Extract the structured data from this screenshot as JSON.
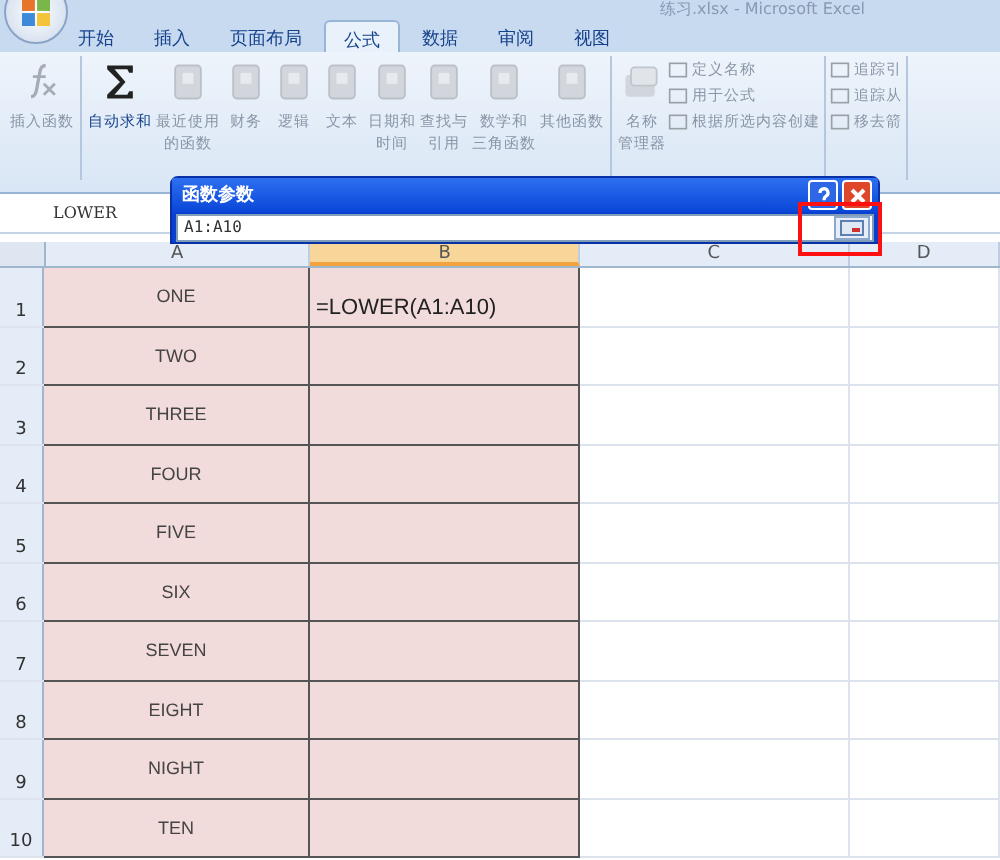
{
  "window": {
    "title": "练习.xlsx - Microsoft Excel"
  },
  "tabs": [
    {
      "label": "开始",
      "selected": false
    },
    {
      "label": "插入",
      "selected": false
    },
    {
      "label": "页面布局",
      "selected": false
    },
    {
      "label": "公式",
      "selected": true
    },
    {
      "label": "数据",
      "selected": false
    },
    {
      "label": "审阅",
      "selected": false
    },
    {
      "label": "视图",
      "selected": false
    }
  ],
  "ribbon": {
    "groups": [
      {
        "items": [
          {
            "kind": "big",
            "lines": [
              "插入函数"
            ],
            "enabled": false
          }
        ]
      },
      {
        "items": [
          {
            "kind": "big",
            "lines": [
              "自动求和"
            ],
            "enabled": true
          },
          {
            "kind": "big",
            "lines": [
              "最近使用",
              "的函数"
            ],
            "enabled": false
          },
          {
            "kind": "big",
            "lines": [
              "财务"
            ],
            "enabled": false
          },
          {
            "kind": "big",
            "lines": [
              "逻辑"
            ],
            "enabled": false
          },
          {
            "kind": "big",
            "lines": [
              "文本"
            ],
            "enabled": false
          },
          {
            "kind": "big",
            "lines": [
              "日期和",
              "时间"
            ],
            "enabled": false
          },
          {
            "kind": "big",
            "lines": [
              "查找与",
              "引用"
            ],
            "enabled": false
          },
          {
            "kind": "big",
            "lines": [
              "数学和",
              "三角函数"
            ],
            "enabled": false
          },
          {
            "kind": "big",
            "lines": [
              "其他函数"
            ],
            "enabled": false
          }
        ]
      },
      {
        "items": [
          {
            "kind": "big",
            "lines": [
              "名称",
              "管理器"
            ],
            "enabled": false
          },
          {
            "kind": "small",
            "lines": [
              "定义名称"
            ],
            "enabled": false
          },
          {
            "kind": "small",
            "lines": [
              "用于公式"
            ],
            "enabled": false
          },
          {
            "kind": "small",
            "lines": [
              "根据所选内容创建"
            ],
            "enabled": false
          }
        ]
      },
      {
        "items": [
          {
            "kind": "small",
            "lines": [
              "追踪引"
            ],
            "enabled": false
          },
          {
            "kind": "small",
            "lines": [
              "追踪从"
            ],
            "enabled": false
          },
          {
            "kind": "small",
            "lines": [
              "移去箭"
            ],
            "enabled": false
          }
        ]
      }
    ]
  },
  "name_box": "LOWER",
  "dialog": {
    "title": "函数参数",
    "value": "A1:A10"
  },
  "columns": [
    "A",
    "B",
    "C",
    "D"
  ],
  "rows": [
    {
      "number": "1",
      "a": "ONE",
      "b": "=LOWER(A1:A10)"
    },
    {
      "number": "2",
      "a": "TWO"
    },
    {
      "number": "3",
      "a": "THREE"
    },
    {
      "number": "4",
      "a": "FOUR"
    },
    {
      "number": "5",
      "a": "FIVE"
    },
    {
      "number": "6",
      "a": "SIX"
    },
    {
      "number": "7",
      "a": "SEVEN"
    },
    {
      "number": "8",
      "a": "EIGHT"
    },
    {
      "number": "9",
      "a": "NIGHT"
    },
    {
      "number": "10",
      "a": "TEN"
    }
  ]
}
